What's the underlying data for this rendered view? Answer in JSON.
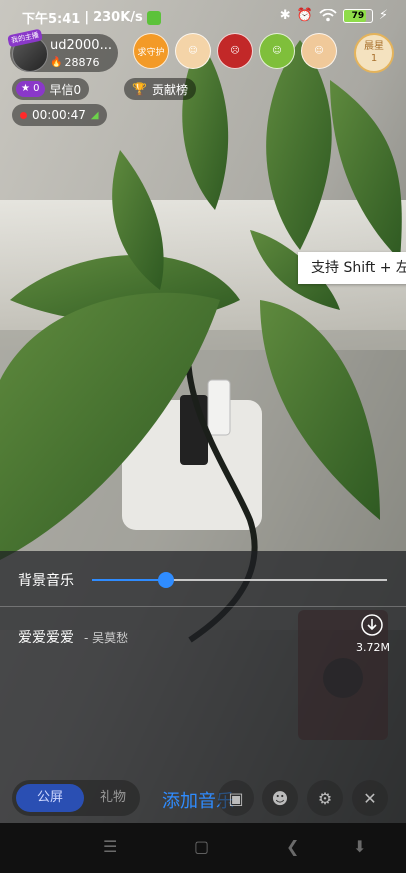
{
  "status_bar": {
    "time": "下午5:41",
    "net_speed": "230K/s",
    "battery": "79",
    "battery_level": 0.79,
    "icons": [
      "app-badge-icon",
      "bluetooth-icon",
      "alarm-icon",
      "wifi-icon",
      "battery-icon",
      "charging-icon"
    ]
  },
  "host": {
    "name": "ud2000...",
    "score": "28876",
    "tag": "我的主播"
  },
  "viewers": {
    "guard_label": "求守护",
    "rank_label": "晨星",
    "rank_number": "1"
  },
  "pills": {
    "level": "0",
    "star_label": "早信0",
    "contribution_label": "贡献榜",
    "live_time": "00:00:47"
  },
  "tooltip": {
    "text": "支持 Shift + 左"
  },
  "music_panel": {
    "bgm_label": "背景音乐",
    "volume": 0.25,
    "song_title": "爱爱爱爱",
    "song_artist": "- 吴莫愁",
    "file_size": "3.72M"
  },
  "bottom_bar": {
    "public_label": "公屏",
    "gift_label": "礼物",
    "add_music_label": "添加音乐"
  },
  "colors": {
    "accent": "#2f8cff",
    "level_badge": "#8a38c9",
    "rank_badge": "#e4b35b"
  }
}
